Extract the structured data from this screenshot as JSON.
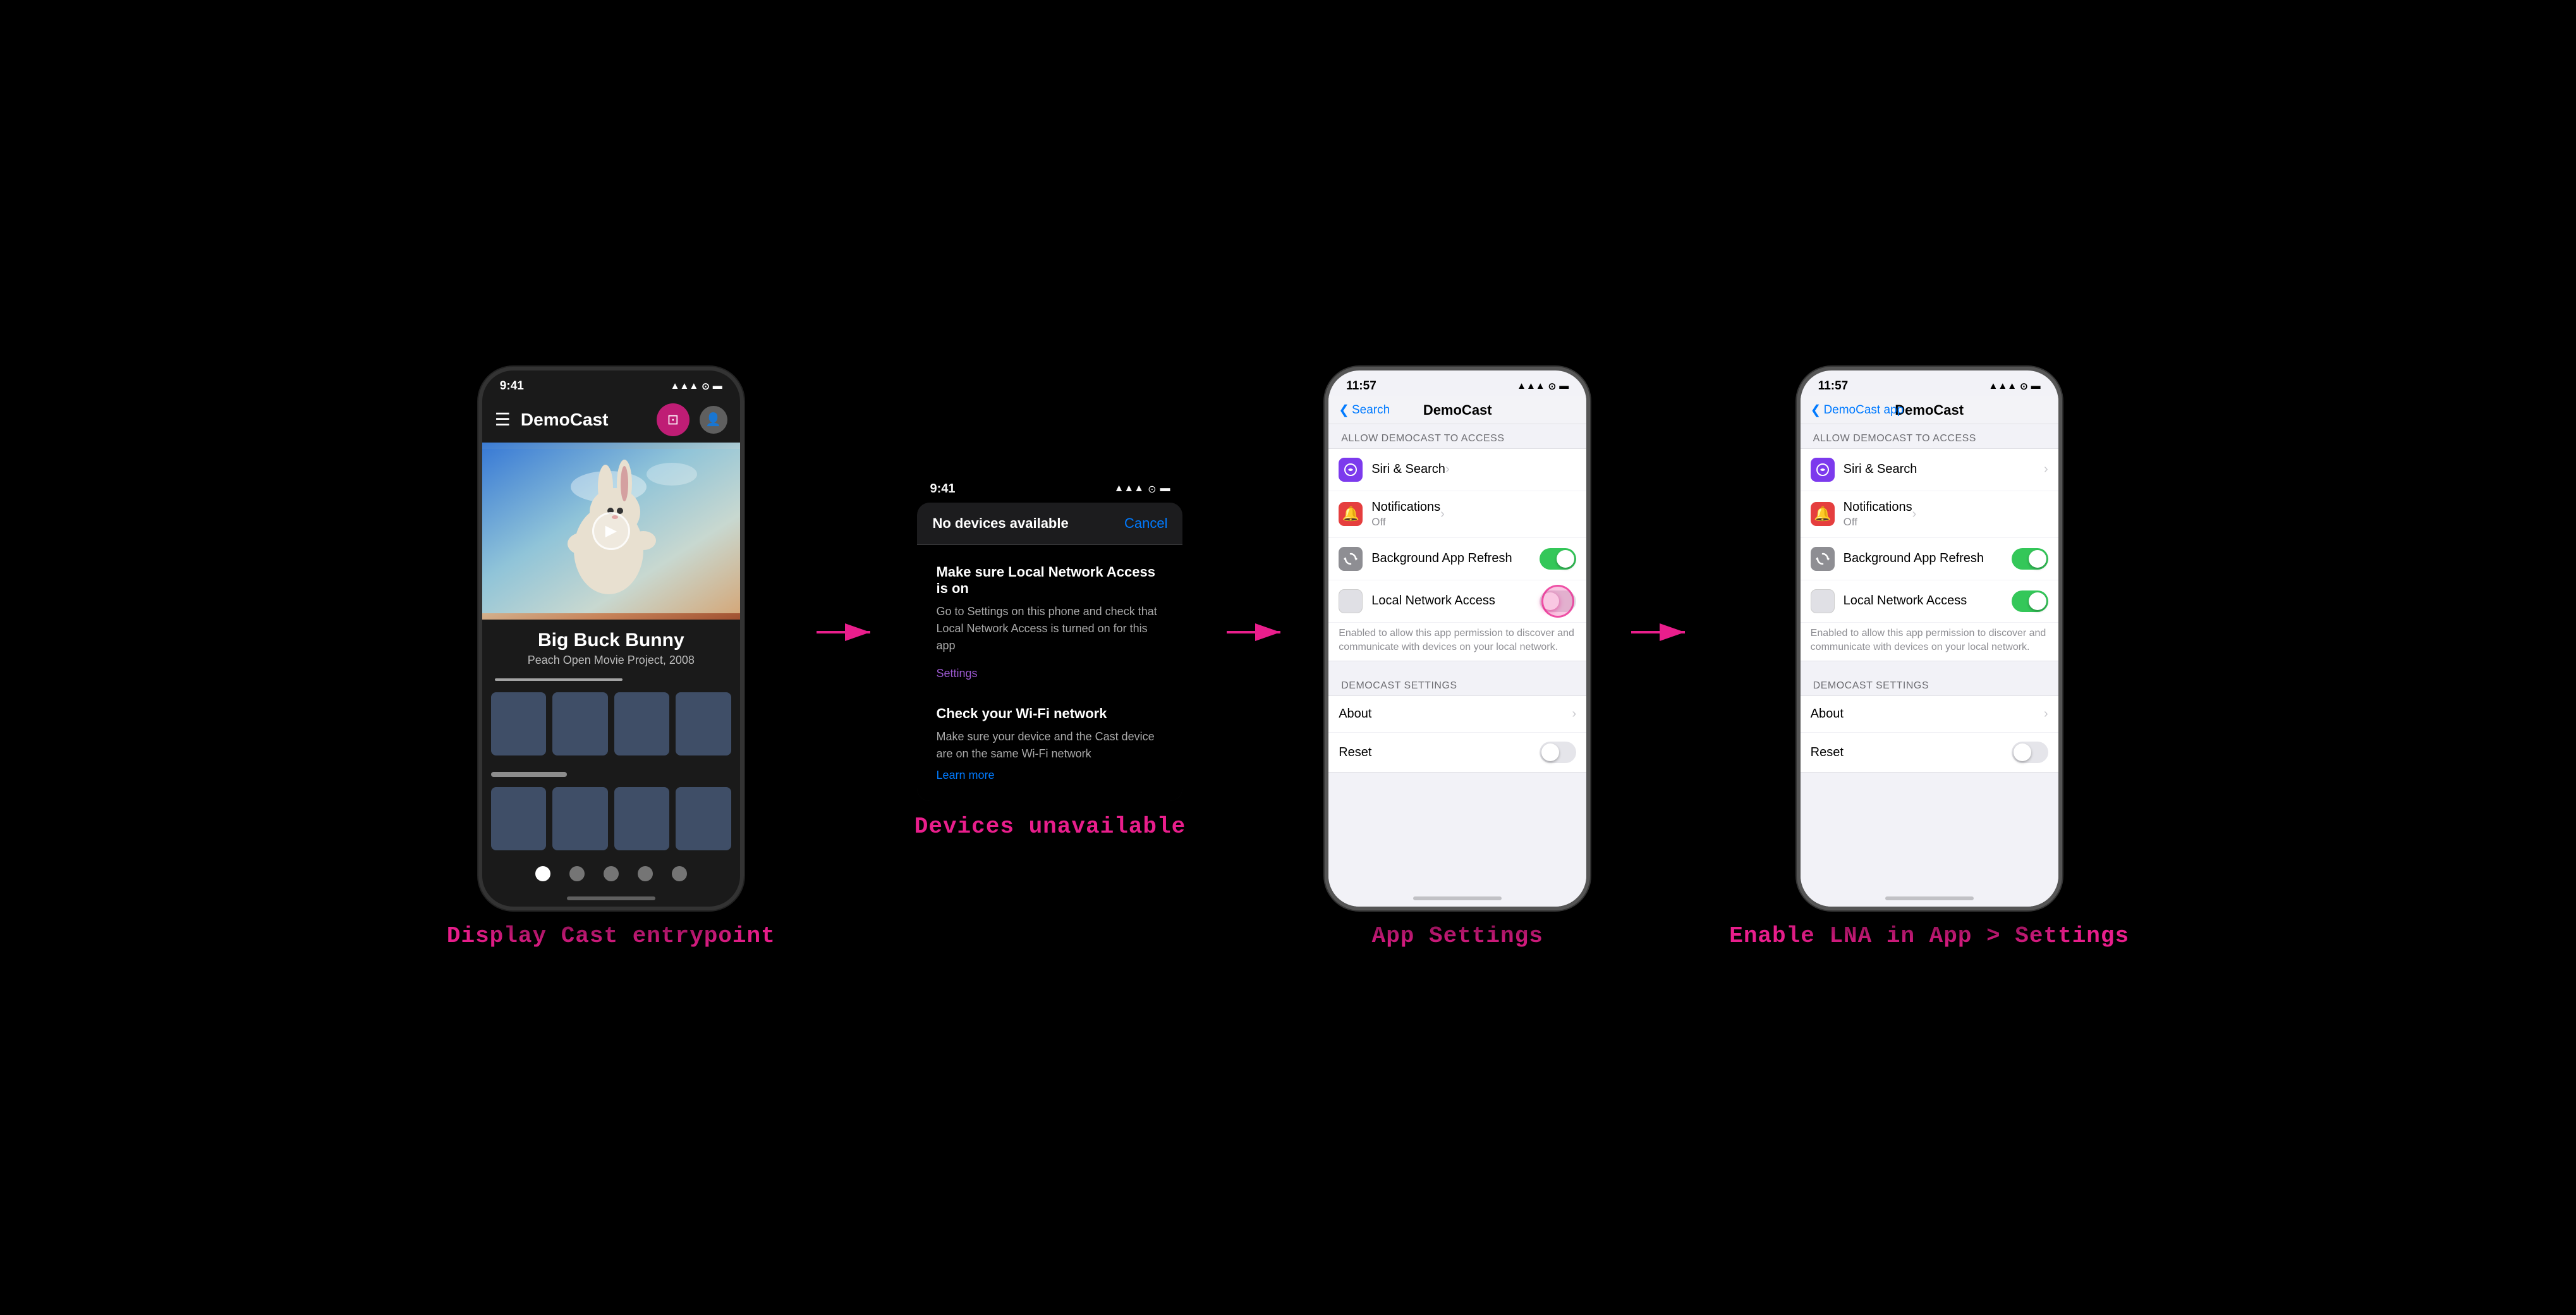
{
  "sections": [
    {
      "id": "section1",
      "caption": "Display Cast entrypoint",
      "phone": {
        "type": "dark",
        "status": {
          "time": "9:41",
          "signal": "▲▲▲",
          "wifi": "WiFi",
          "battery": "■■■"
        },
        "app": {
          "title": "DemoCast",
          "movie_title": "Big Buck Bunny",
          "movie_subtitle": "Peach Open Movie Project, 2008"
        }
      }
    },
    {
      "id": "section2",
      "caption": "Devices unavailable",
      "popup": {
        "status": {
          "time": "9:41",
          "signal": "▲▲▲",
          "wifi": "WiFi",
          "battery": "■■■"
        },
        "header": {
          "title": "No devices available",
          "cancel": "Cancel"
        },
        "troubleshoot1": {
          "title": "Make sure Local Network Access is on",
          "text": "Go to Settings on this phone and check that Local Network Access is turned on for this app",
          "link": "Settings"
        },
        "troubleshoot2": {
          "title": "Check your Wi-Fi network",
          "text": "Make sure your device and the Cast device are on the same Wi-Fi network",
          "link": "Learn more"
        }
      }
    },
    {
      "id": "section3",
      "caption": "App Settings",
      "settings": {
        "nav_back": "◀ Search",
        "title": "DemoCast",
        "section_header": "ALLOW DEMOCAST TO ACCESS",
        "items": [
          {
            "icon_type": "purple",
            "icon_emoji": "✦",
            "label": "Siri & Search",
            "sublabel": "",
            "right": "chevron"
          },
          {
            "icon_type": "red",
            "icon_emoji": "🔔",
            "label": "Notifications",
            "sublabel": "Off",
            "right": "chevron"
          },
          {
            "icon_type": "gray",
            "icon_emoji": "⚙",
            "label": "Background App Refresh",
            "sublabel": "",
            "right": "toggle-on"
          },
          {
            "icon_type": "plain",
            "icon_emoji": "",
            "label": "Local Network Access",
            "sublabel": "",
            "right": "toggle-pink",
            "description": "Enabled to allow this app permission to discover and communicate with devices on your local network."
          }
        ],
        "section_header2": "DEMOCAST SETTINGS",
        "items2": [
          {
            "label": "About",
            "right": "chevron"
          },
          {
            "label": "Reset",
            "right": "toggle-off"
          }
        ]
      }
    },
    {
      "id": "section4",
      "caption": "Enable LNA in App > Settings",
      "settings": {
        "nav_back": "◀ DemoCast app",
        "title": "DemoCast",
        "section_header": "ALLOW DEMOCAST TO ACCESS",
        "items": [
          {
            "icon_type": "purple",
            "icon_emoji": "✦",
            "label": "Siri & Search",
            "sublabel": "",
            "right": "chevron"
          },
          {
            "icon_type": "red",
            "icon_emoji": "🔔",
            "label": "Notifications",
            "sublabel": "Off",
            "right": "chevron"
          },
          {
            "icon_type": "gray",
            "icon_emoji": "⚙",
            "label": "Background App Refresh",
            "sublabel": "",
            "right": "toggle-on"
          },
          {
            "icon_type": "plain",
            "icon_emoji": "",
            "label": "Local Network Access",
            "sublabel": "",
            "right": "toggle-on",
            "description": "Enabled to allow this app permission to discover and communicate with devices on your local network."
          }
        ],
        "section_header2": "DEMOCAST SETTINGS",
        "items2": [
          {
            "label": "About",
            "right": "chevron"
          },
          {
            "label": "Reset",
            "right": "toggle-off"
          }
        ]
      }
    }
  ],
  "captions": {
    "section1": "Display Cast entrypoint",
    "section2": "Devices unavailable",
    "section3": "App Settings",
    "section4": "Enable LNA in App > Settings"
  }
}
